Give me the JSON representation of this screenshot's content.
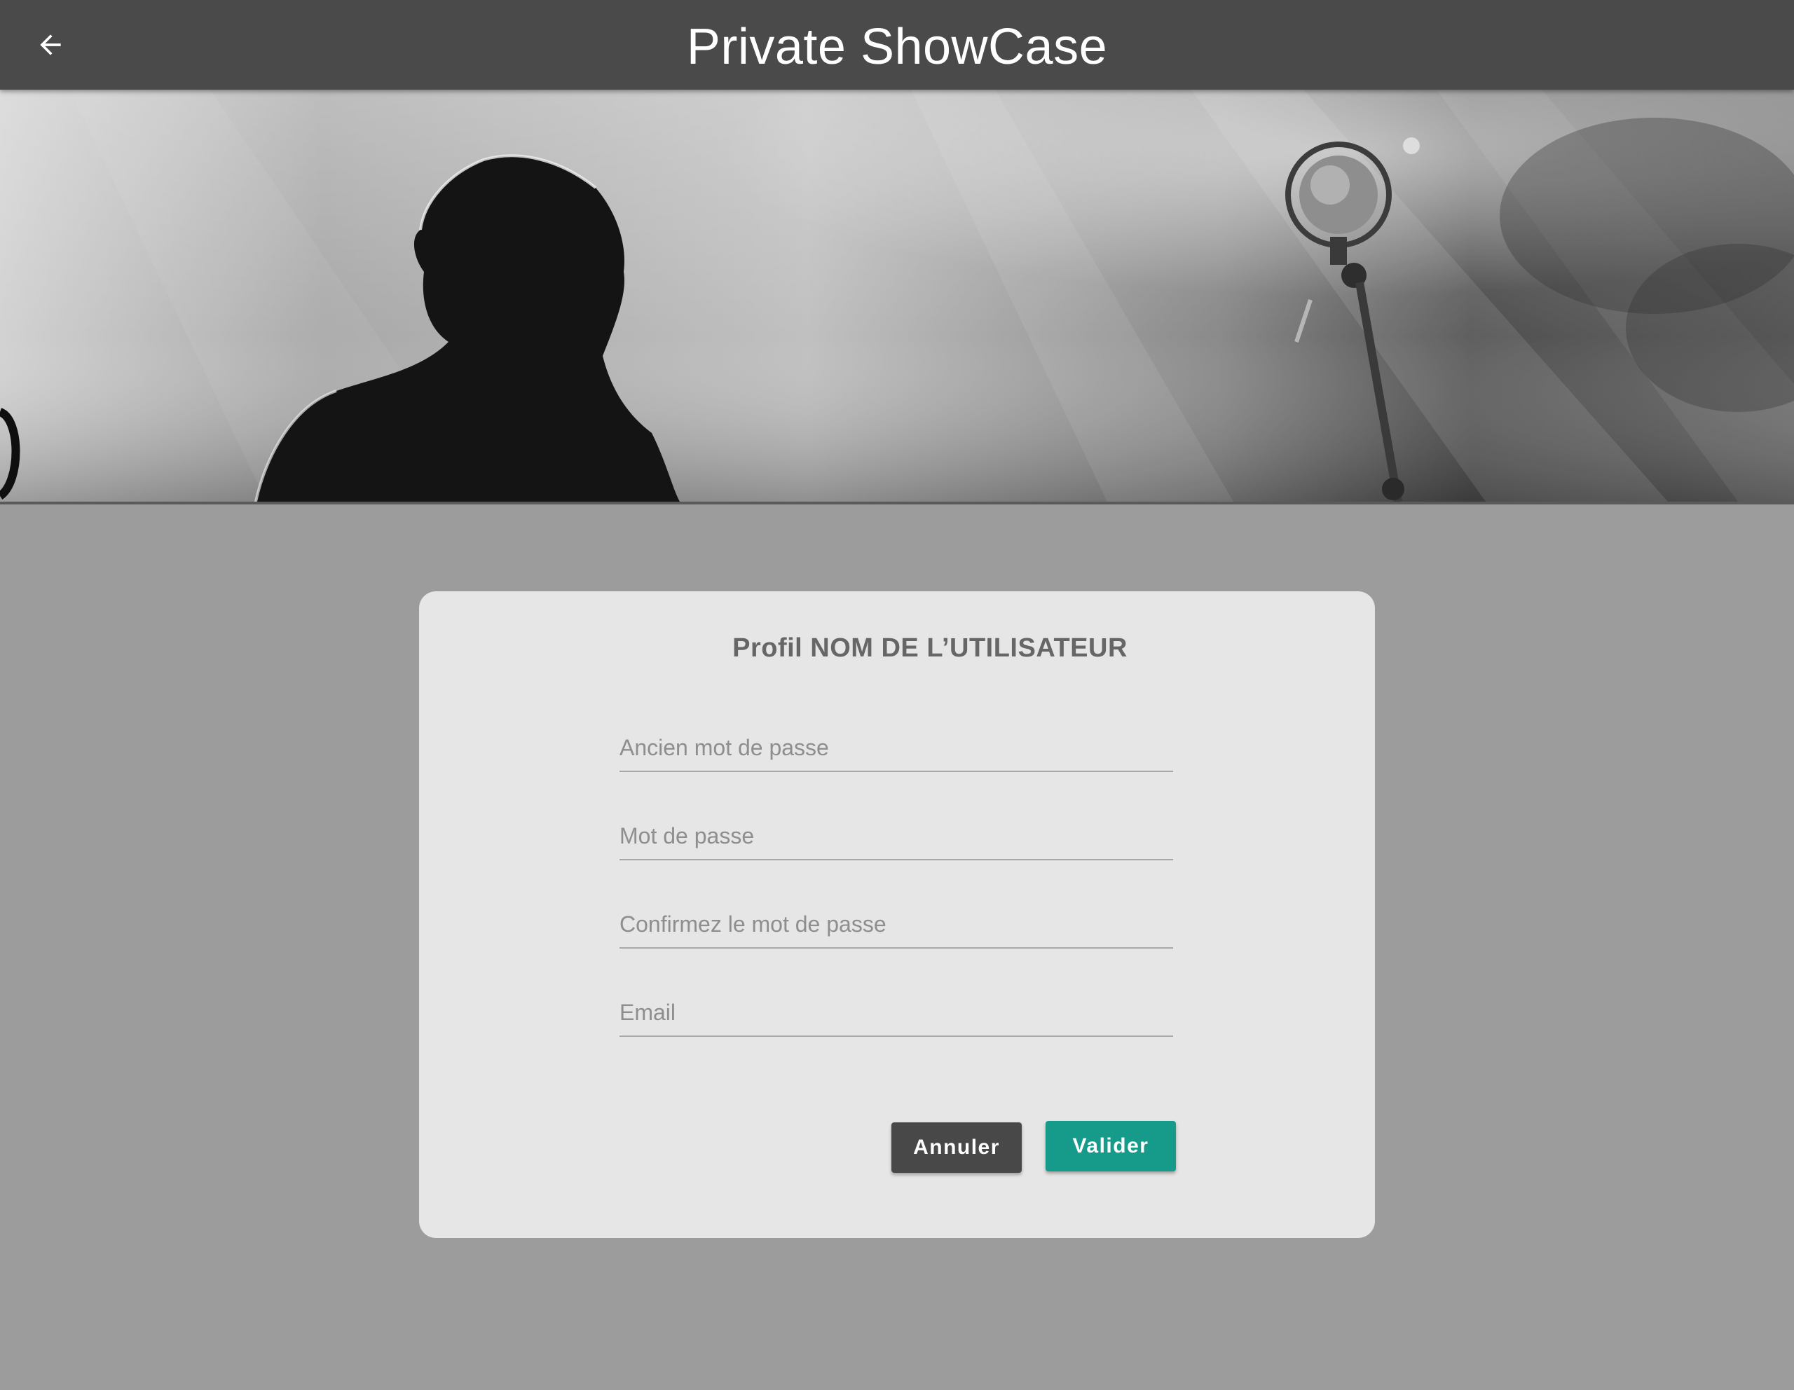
{
  "appbar": {
    "title": "Private ShowCase",
    "back_icon": "arrow-back-icon"
  },
  "hero": {
    "image": "concert-singer-with-microphone-photo"
  },
  "card": {
    "title": "Profil NOM DE L’UTILISATEUR",
    "fields": {
      "old_password": {
        "placeholder": "Ancien mot de passe",
        "value": ""
      },
      "password": {
        "placeholder": "Mot de passe",
        "value": ""
      },
      "confirm_password": {
        "placeholder": "Confirmez le mot de passe",
        "value": ""
      },
      "email": {
        "placeholder": "Email",
        "value": ""
      }
    },
    "buttons": {
      "cancel_label": "Annuler",
      "validate_label": "Valider"
    }
  },
  "colors": {
    "appbar": "#4a4a4a",
    "background": "#9c9c9c",
    "card": "#e6e6e6",
    "cancel_button": "#484848",
    "validate_button": "#169a8a"
  }
}
